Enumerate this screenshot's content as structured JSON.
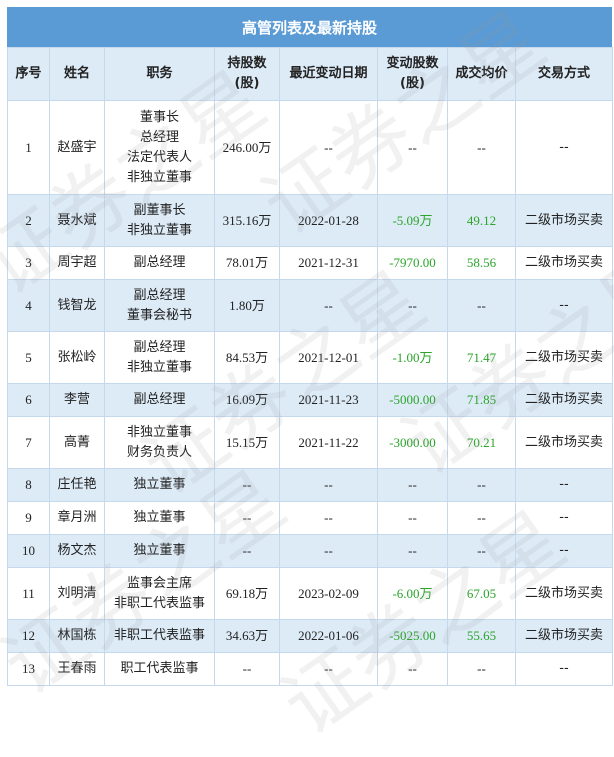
{
  "title": "高管列表及最新持股",
  "headers": [
    "序号",
    "姓名",
    "职务",
    "持股数\n(股)",
    "最近变动日期",
    "变动股数\n(股)",
    "成交均价",
    "交易方式"
  ],
  "rows": [
    {
      "no": "1",
      "name": "赵盛宇",
      "roles": [
        "董事长",
        "总经理",
        "法定代表人",
        "非独立董事"
      ],
      "shares": "246.00万",
      "date": "--",
      "change": "--",
      "price": "--",
      "method": "--"
    },
    {
      "no": "2",
      "name": "聂水斌",
      "roles": [
        "副董事长",
        "非独立董事"
      ],
      "shares": "315.16万",
      "date": "2022-01-28",
      "change": "-5.09万",
      "price": "49.12",
      "method": "二级市场买卖"
    },
    {
      "no": "3",
      "name": "周宇超",
      "roles": [
        "副总经理"
      ],
      "shares": "78.01万",
      "date": "2021-12-31",
      "change": "-7970.00",
      "price": "58.56",
      "method": "二级市场买卖"
    },
    {
      "no": "4",
      "name": "钱智龙",
      "roles": [
        "副总经理",
        "董事会秘书"
      ],
      "shares": "1.80万",
      "date": "--",
      "change": "--",
      "price": "--",
      "method": "--"
    },
    {
      "no": "5",
      "name": "张松岭",
      "roles": [
        "副总经理",
        "非独立董事"
      ],
      "shares": "84.53万",
      "date": "2021-12-01",
      "change": "-1.00万",
      "price": "71.47",
      "method": "二级市场买卖"
    },
    {
      "no": "6",
      "name": "李营",
      "roles": [
        "副总经理"
      ],
      "shares": "16.09万",
      "date": "2021-11-23",
      "change": "-5000.00",
      "price": "71.85",
      "method": "二级市场买卖"
    },
    {
      "no": "7",
      "name": "高菁",
      "roles": [
        "非独立董事",
        "财务负责人"
      ],
      "shares": "15.15万",
      "date": "2021-11-22",
      "change": "-3000.00",
      "price": "70.21",
      "method": "二级市场买卖"
    },
    {
      "no": "8",
      "name": "庄任艳",
      "roles": [
        "独立董事"
      ],
      "shares": "--",
      "date": "--",
      "change": "--",
      "price": "--",
      "method": "--"
    },
    {
      "no": "9",
      "name": "章月洲",
      "roles": [
        "独立董事"
      ],
      "shares": "--",
      "date": "--",
      "change": "--",
      "price": "--",
      "method": "--"
    },
    {
      "no": "10",
      "name": "杨文杰",
      "roles": [
        "独立董事"
      ],
      "shares": "--",
      "date": "--",
      "change": "--",
      "price": "--",
      "method": "--"
    },
    {
      "no": "11",
      "name": "刘明清",
      "roles": [
        "监事会主席",
        "非职工代表监事"
      ],
      "shares": "69.18万",
      "date": "2023-02-09",
      "change": "-6.00万",
      "price": "67.05",
      "method": "二级市场买卖"
    },
    {
      "no": "12",
      "name": "林国栋",
      "roles": [
        "非职工代表监事"
      ],
      "shares": "34.63万",
      "date": "2022-01-06",
      "change": "-5025.00",
      "price": "55.65",
      "method": "二级市场买卖"
    },
    {
      "no": "13",
      "name": "王春雨",
      "roles": [
        "职工代表监事"
      ],
      "shares": "--",
      "date": "--",
      "change": "--",
      "price": "--",
      "method": "--"
    }
  ],
  "watermark": "证券之星",
  "colors": {
    "header_bar": "#5b9bd5",
    "header_row": "#ddebf7",
    "stripe": "#ddebf7",
    "negative": "#2aa52a",
    "border": "#c5d8ec"
  }
}
